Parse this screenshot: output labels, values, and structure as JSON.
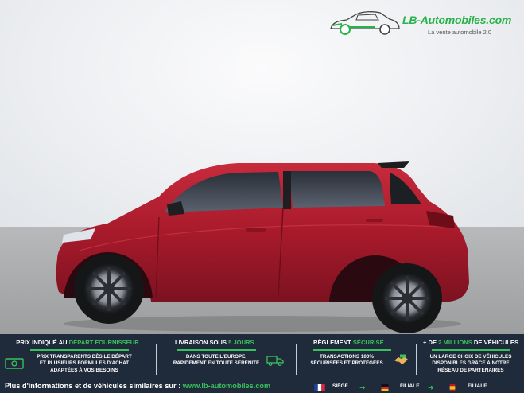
{
  "logo": {
    "name": "LB-Automobiles.com",
    "tagline": "La vente automobile 2.0"
  },
  "photo": {
    "subject": "red-hatchback-side-view"
  },
  "band": {
    "col1": {
      "title_prefix": "PRIX INDIQUÉ AU",
      "title_highlight": "DÉPART FOURNISSEUR",
      "lines": [
        "PRIX TRANSPARENTS DÈS LE DÉPART",
        "ET PLUSIEURS FORMULES D'ACHAT",
        "ADAPTÉES À VOS BESOINS"
      ]
    },
    "col2": {
      "title_prefix": "LIVRAISON SOUS",
      "title_highlight": "5 JOURS",
      "lines": [
        "DANS TOUTE L'EUROPE,",
        "RAPIDEMENT EN TOUTE SÉRÉNITÉ"
      ]
    },
    "col3": {
      "title_prefix": "RÈGLEMENT",
      "title_highlight": "SÉCURISÉ",
      "lines": [
        "TRANSACTIONS 100%",
        "SÉCURISÉES ET PROTÉGÉES"
      ]
    },
    "col4": {
      "title_prefix": "+ DE",
      "title_highlight": "2 MILLIONS",
      "title_suffix": "DE VÉHICULES",
      "lines": [
        "UN LARGE CHOIX DE VÉHICULES",
        "DISPONIBLES GRÂCE À NOTRE",
        "RÉSEAU DE PARTENAIRES"
      ]
    }
  },
  "footer": {
    "text": "Plus d'informations et de véhicules similaires sur : ",
    "link": "www.lb-automobiles.com",
    "flags": [
      {
        "label": "SIÈGE"
      },
      {
        "label": "FILIALE"
      },
      {
        "label": "FILIALE"
      }
    ]
  },
  "colors": {
    "accent": "#39c25b",
    "band": "#1f2a3a",
    "car": "#b01f2e"
  }
}
